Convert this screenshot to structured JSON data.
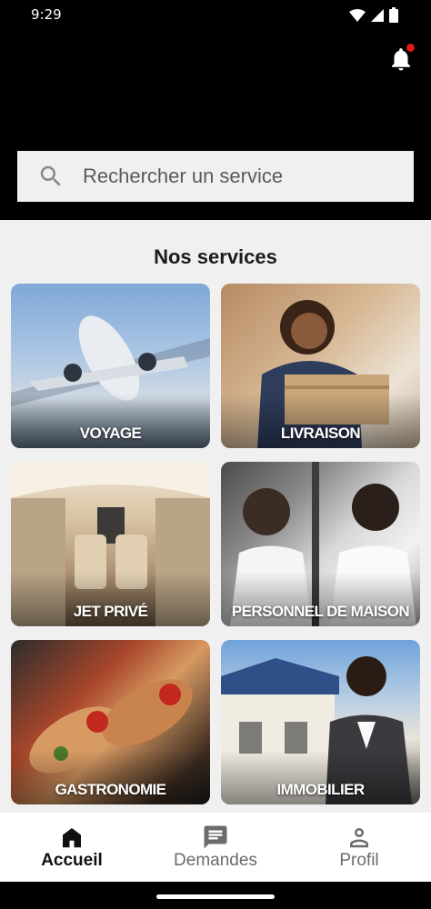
{
  "status_bar": {
    "time": "9:29",
    "icons": [
      "wifi-icon",
      "signal-icon",
      "battery-icon"
    ]
  },
  "header": {
    "notification_icon": "bell-icon",
    "has_unread": true
  },
  "search": {
    "placeholder": "Rechercher un service",
    "icon": "search-icon"
  },
  "services": {
    "title": "Nos services",
    "items": [
      {
        "label": "VOYAGE"
      },
      {
        "label": "LIVRAISON"
      },
      {
        "label": "JET PRIVÉ"
      },
      {
        "label": "PERSONNEL DE MAISON"
      },
      {
        "label": "GASTRONOMIE"
      },
      {
        "label": "IMMOBILIER"
      }
    ]
  },
  "bottom_nav": {
    "items": [
      {
        "label": "Accueil",
        "icon": "home-icon",
        "active": true
      },
      {
        "label": "Demandes",
        "icon": "chat-icon",
        "active": false
      },
      {
        "label": "Profil",
        "icon": "person-icon",
        "active": false
      }
    ]
  },
  "colors": {
    "accent": "#111111",
    "badge": "#e01919",
    "background": "#f1f0f0"
  }
}
